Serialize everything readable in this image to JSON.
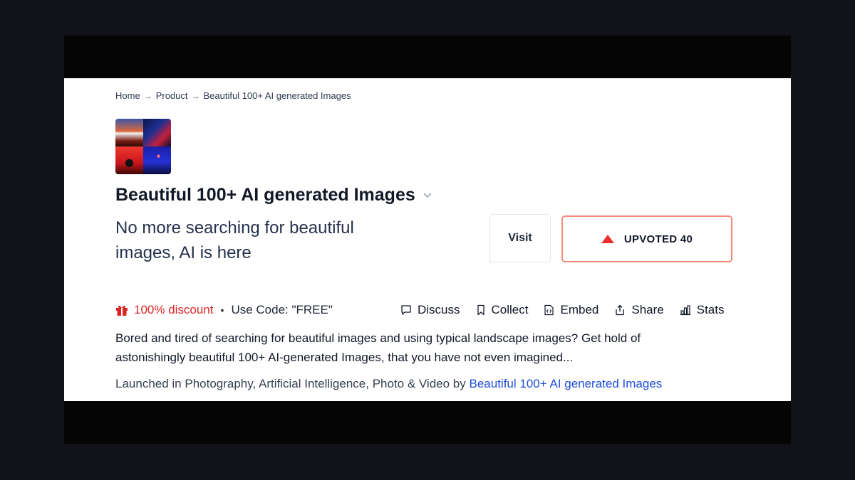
{
  "breadcrumb": {
    "home": "Home",
    "product": "Product",
    "current": "Beautiful 100+ AI generated Images",
    "separator": "→"
  },
  "product": {
    "title": "Beautiful 100+ AI generated Images",
    "tagline": "No more searching for beautiful images, AI is here",
    "description": "Bored and tired of searching for beautiful images and using typical landscape images? Get hold of astonishingly beautiful 100+ AI-generated Images, that you have not even imagined...",
    "thumbnail_icon": "collage-thumbnail"
  },
  "buttons": {
    "visit": "Visit",
    "upvote": "UPVOTED 40"
  },
  "promo": {
    "discount": "100% discount",
    "dot": "•",
    "code": "Use Code: \"FREE\"",
    "icon": "gift-icon"
  },
  "actions": {
    "discuss": "Discuss",
    "collect": "Collect",
    "embed": "Embed",
    "share": "Share",
    "stats": "Stats"
  },
  "launched": {
    "prefix": "Launched in Photography, Artificial Intelligence, Photo & Video by",
    "maker": "Beautiful 100+ AI generated Images"
  },
  "colors": {
    "accent_red": "#ee2e2e",
    "upvote_border": "#f48a7a",
    "link_blue": "#1d4ed8",
    "text_dark": "#111827"
  }
}
